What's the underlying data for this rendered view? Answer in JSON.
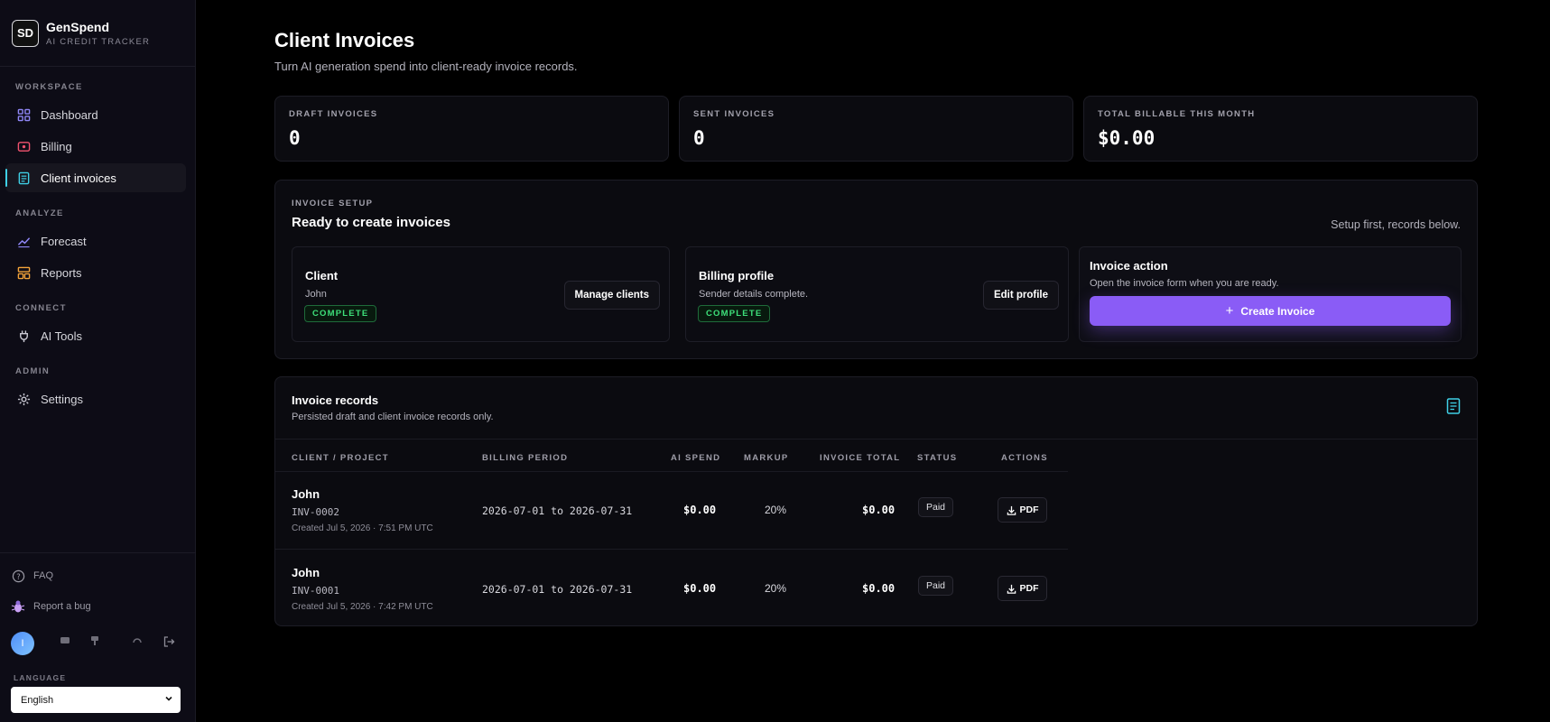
{
  "brand": {
    "logo_text": "SD",
    "name": "GenSpend",
    "tagline": "AI CREDIT TRACKER"
  },
  "sidebar": {
    "sections": {
      "workspace": "WORKSPACE",
      "analyze": "ANALYZE",
      "connect": "CONNECT",
      "admin": "ADMIN"
    },
    "items": [
      {
        "label": "Dashboard",
        "icon": "grid-icon"
      },
      {
        "label": "Billing",
        "icon": "billing-icon"
      },
      {
        "label": "Client invoices",
        "icon": "document-icon",
        "active": true
      },
      {
        "label": "Forecast",
        "icon": "trend-icon"
      },
      {
        "label": "Reports",
        "icon": "layout-icon"
      },
      {
        "label": "AI Tools",
        "icon": "plug-icon"
      },
      {
        "label": "Settings",
        "icon": "gear-icon"
      }
    ],
    "footer": {
      "faq": "FAQ",
      "report_bug": "Report a bug",
      "avatar_initial": "I",
      "language_label": "LANGUAGE",
      "language_value": "English"
    }
  },
  "page": {
    "title": "Client Invoices",
    "subtitle": "Turn AI generation spend into client-ready invoice records."
  },
  "stats": [
    {
      "label": "DRAFT INVOICES",
      "value": "0"
    },
    {
      "label": "SENT INVOICES",
      "value": "0"
    },
    {
      "label": "TOTAL BILLABLE THIS MONTH",
      "value": "$0.00"
    }
  ],
  "setup": {
    "kicker": "INVOICE SETUP",
    "title": "Ready to create invoices",
    "hint": "Setup first, records below.",
    "client": {
      "title": "Client",
      "value": "John",
      "badge": "COMPLETE",
      "button": "Manage clients"
    },
    "billing_profile": {
      "title": "Billing profile",
      "value": "Sender details complete.",
      "badge": "COMPLETE",
      "button": "Edit profile"
    },
    "invoice_action": {
      "title": "Invoice action",
      "text": "Open the invoice form when you are ready.",
      "button": "Create Invoice"
    }
  },
  "records": {
    "title": "Invoice records",
    "subtitle": "Persisted draft and client invoice records only.",
    "columns": [
      "CLIENT / PROJECT",
      "BILLING PERIOD",
      "AI SPEND",
      "MARKUP",
      "INVOICE TOTAL",
      "STATUS",
      "ACTIONS"
    ],
    "rows": [
      {
        "client": "John",
        "invoice_id": "INV-0002",
        "created": "Created Jul 5, 2026 · 7:51 PM UTC",
        "period": "2026-07-01 to 2026-07-31",
        "ai_spend": "$0.00",
        "markup": "20%",
        "total": "$0.00",
        "status": "Paid",
        "action": "PDF"
      },
      {
        "client": "John",
        "invoice_id": "INV-0001",
        "created": "Created Jul 5, 2026 · 7:42 PM UTC",
        "period": "2026-07-01 to 2026-07-31",
        "ai_spend": "$0.00",
        "markup": "20%",
        "total": "$0.00",
        "status": "Paid",
        "action": "PDF"
      }
    ]
  },
  "colors": {
    "accent": "#8a5cf6",
    "active_indicator": "#3fd0e6",
    "badge_green": "#3ee07a"
  }
}
